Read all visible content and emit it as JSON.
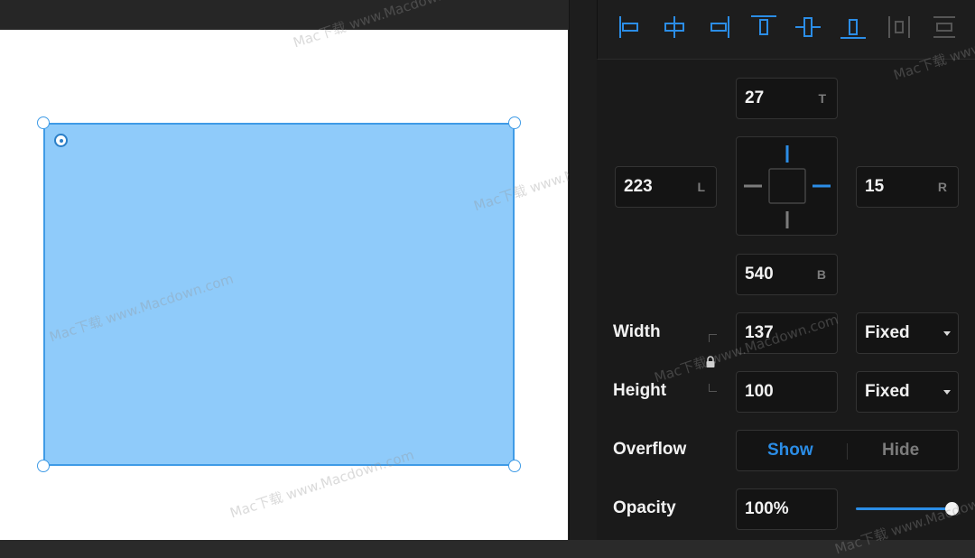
{
  "canvas": {
    "watermark": "Mac下载 www.Macdown.com"
  },
  "alignment": {
    "buttons": [
      {
        "name": "align-left-icon"
      },
      {
        "name": "align-horizontal-center-icon"
      },
      {
        "name": "align-right-icon"
      },
      {
        "name": "align-top-icon"
      },
      {
        "name": "align-vertical-center-icon"
      },
      {
        "name": "align-bottom-icon"
      },
      {
        "name": "distribute-horizontal-icon"
      },
      {
        "name": "distribute-vertical-icon"
      }
    ]
  },
  "position": {
    "top": {
      "value": "27",
      "suffix": "T"
    },
    "left": {
      "value": "223",
      "suffix": "L"
    },
    "right": {
      "value": "15",
      "suffix": "R"
    },
    "bottom": {
      "value": "540",
      "suffix": "B"
    }
  },
  "size": {
    "width_label": "Width",
    "width_value": "137",
    "width_mode": "Fixed",
    "height_label": "Height",
    "height_value": "100",
    "height_mode": "Fixed"
  },
  "overflow": {
    "label": "Overflow",
    "show": "Show",
    "hide": "Hide",
    "selected": "Show"
  },
  "opacity": {
    "label": "Opacity",
    "value": "100%",
    "level": 1.0
  },
  "colors": {
    "accent": "#2b8de6",
    "shape_fill": "#8fcbfa",
    "shape_stroke": "#3f9be6",
    "panel_bg": "#1a1a1a",
    "muted_text": "#7c7c7c"
  }
}
